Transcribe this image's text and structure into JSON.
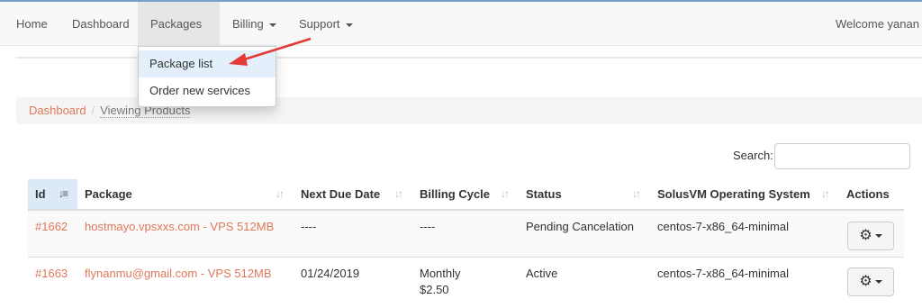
{
  "nav": {
    "items": [
      {
        "label": "Home"
      },
      {
        "label": "Dashboard"
      },
      {
        "label": "Packages"
      },
      {
        "label": "Billing"
      },
      {
        "label": "Support"
      }
    ],
    "welcome": "Welcome yanan z"
  },
  "dropdown": {
    "items": [
      {
        "label": "Package list"
      },
      {
        "label": "Order new services"
      }
    ]
  },
  "breadcrumb": {
    "link": "Dashboard",
    "separator": "/",
    "current": "Viewing Products"
  },
  "search": {
    "label": "Search:",
    "value": ""
  },
  "table": {
    "columns": [
      "Id",
      "Package",
      "Next Due Date",
      "Billing Cycle",
      "Status",
      "SolusVM Operating System",
      "Actions"
    ],
    "rows": [
      {
        "id": "#1662",
        "package": "hostmayo.vpsxxs.com - VPS 512MB",
        "due": "----",
        "cycle": "----",
        "cycle_price": "",
        "status": "Pending Cancelation",
        "os": "centos-7-x86_64-minimal"
      },
      {
        "id": "#1663",
        "package": "flynanmu@gmail.com - VPS 512MB",
        "due": "01/24/2019",
        "cycle": "Monthly",
        "cycle_price": "$2.50",
        "status": "Active",
        "os": "centos-7-x86_64-minimal"
      }
    ]
  },
  "colors": {
    "link": "#e0785b",
    "navbar": "#f8f8f8",
    "arrow": "#e53935",
    "sorted_header": "#dce9f6"
  }
}
